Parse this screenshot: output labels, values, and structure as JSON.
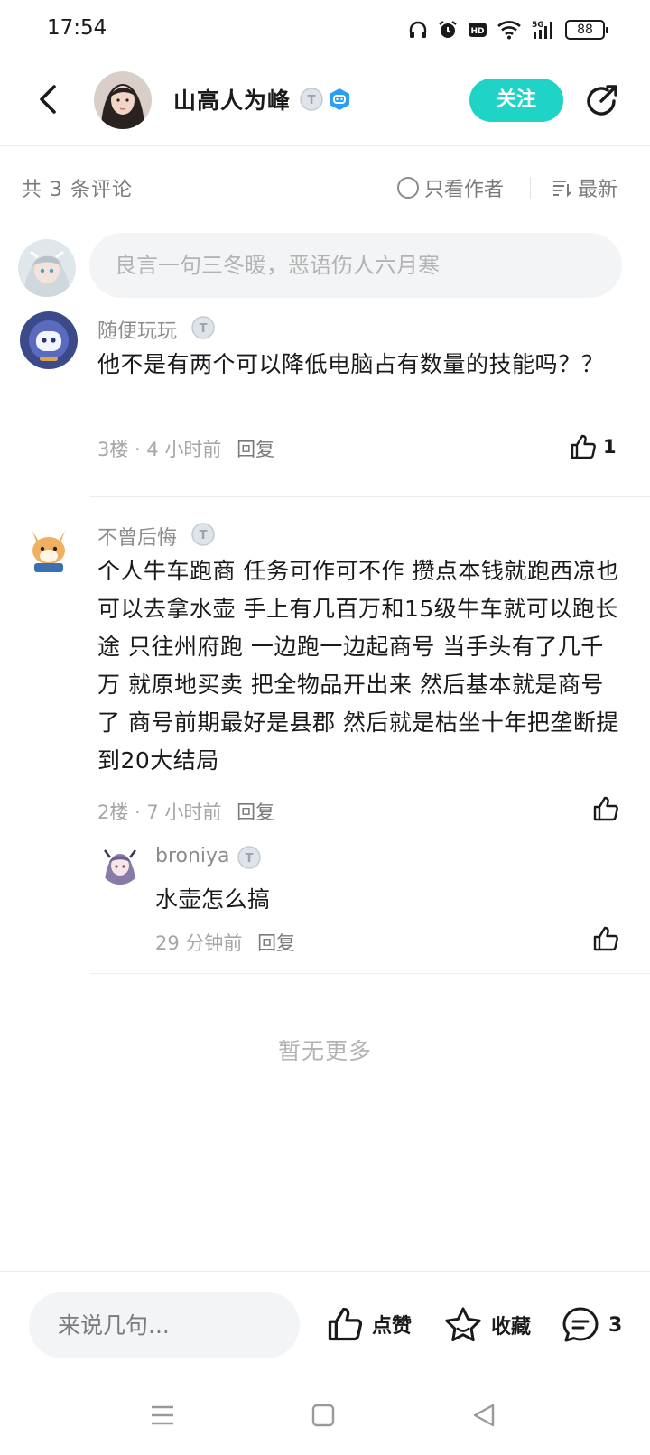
{
  "status_bar": {
    "time": "17:54",
    "battery": "88",
    "network": "5G"
  },
  "header": {
    "author_name": "山高人为峰",
    "follow_label": "关注"
  },
  "toolbar": {
    "count_label": "共 3 条评论",
    "author_only_label": "只看作者",
    "sort_label": "最新"
  },
  "composer": {
    "placeholder": "良言一句三冬暖，恶语伤人六月寒"
  },
  "comments": [
    {
      "name": "随便玩玩",
      "text": "他不是有两个可以降低电脑占有数量的技能吗？？",
      "meta": "3楼 · 4 小时前",
      "reply_label": "回复",
      "likes": "1"
    },
    {
      "name": "不曾后悔",
      "text": "个人牛车跑商 任务可作可不作 攒点本钱就跑西凉也可以去拿水壶 手上有几百万和15级牛车就可以跑长途 只往州府跑 一边跑一边起商号 当手头有了几千万 就原地买卖 把全物品开出来 然后基本就是商号了 商号前期最好是县郡 然后就是枯坐十年把垄断提到20大结局",
      "meta": "2楼 · 7 小时前",
      "reply_label": "回复",
      "likes": "",
      "replies": [
        {
          "name": "broniya",
          "text": "水壶怎么搞",
          "meta": "29 分钟前",
          "reply_label": "回复",
          "likes": ""
        }
      ]
    }
  ],
  "no_more_label": "暂无更多",
  "bottom_bar": {
    "input_placeholder": "来说几句...",
    "like_label": "点赞",
    "favorite_label": "收藏",
    "comment_count": "3"
  },
  "colors": {
    "accent": "#1fd3c6",
    "muted_text": "#8c8c8c",
    "background": "#ffffff"
  },
  "icons": [
    "back-arrow-icon",
    "share-icon",
    "tier-badge-icon",
    "game-badge-icon",
    "radio-icon",
    "sort-icon",
    "thumbs-up-icon",
    "star-icon",
    "comment-icon"
  ]
}
